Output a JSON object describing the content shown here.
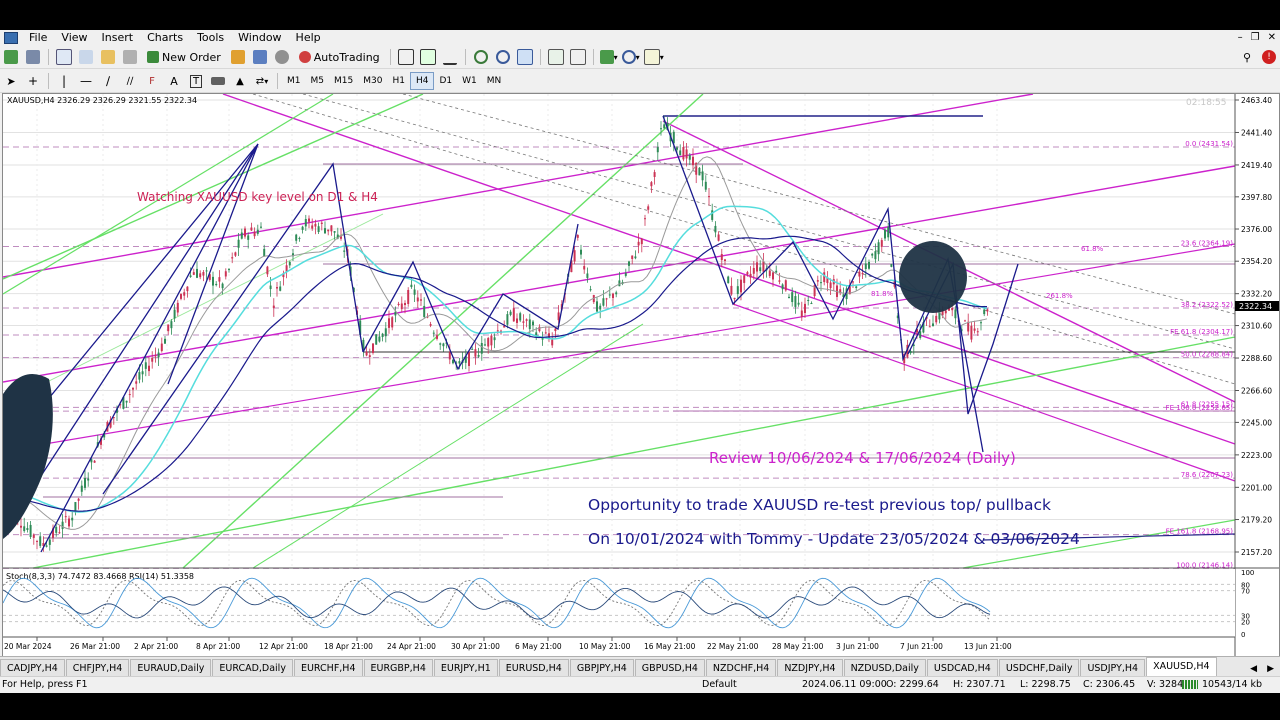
{
  "menu": [
    "File",
    "View",
    "Insert",
    "Charts",
    "Tools",
    "Window",
    "Help"
  ],
  "toolbar": {
    "new_order": "New Order",
    "autotrading": "AutoTrading"
  },
  "timeframes": [
    "M1",
    "M5",
    "M15",
    "M30",
    "H1",
    "H4",
    "D1",
    "W1",
    "MN"
  ],
  "active_timeframe": "H4",
  "chart": {
    "header": "XAUUSD,H4  2326.29 2326.29 2321.55 2322.34",
    "timer": "02:18:55",
    "annotations": {
      "watching": "Watching XAUUSD key level on D1 & H4",
      "review": "Review 10/06/2024 & 17/06/2024 (Daily)",
      "opportunity": "Opportunity to trade XAUUSD re-test previous top/ pullback",
      "update": "On 10/01/2024 with Tommy - Update 23/05/2024 & 03/06/2024"
    },
    "price_labels": [
      "2463.40",
      "2441.40",
      "2419.40",
      "2397.80",
      "2376.00",
      "2354.20",
      "2332.20",
      "2310.60",
      "2288.60",
      "2266.60",
      "2245.00",
      "2223.00",
      "2201.00",
      "2179.20",
      "2157.20"
    ],
    "current_price": "2322.34",
    "fib_labels": [
      {
        "text": "0.0 (2431.54)",
        "price": 2431.54
      },
      {
        "text": "23.6 (2364.19)",
        "price": 2364.19
      },
      {
        "text": "38.2 (2322.52)",
        "price": 2322.52
      },
      {
        "text": "FE 61.8 (2304.17)",
        "price": 2304.17
      },
      {
        "text": "50.0 (2288.84)",
        "price": 2288.84
      },
      {
        "text": "61.8 (2255.15)",
        "price": 2255.15
      },
      {
        "text": "FE 100.0 (2252.65)",
        "price": 2252.65
      },
      {
        "text": "78.6 (2207.23)",
        "price": 2207.23
      },
      {
        "text": "FE 161.8 (2168.95)",
        "price": 2168.95
      },
      {
        "text": "100.0 (2146.14)",
        "price": 2146.14
      }
    ],
    "small_labels": [
      "61.8%",
      "261.8%",
      "81.8%"
    ],
    "indicator_header": "Stoch(8,3,3) 74.7472 83.4668  RSI(14) 51.3358",
    "indicator_labels": [
      "100",
      "80",
      "70",
      "30",
      "20",
      "0"
    ],
    "time_labels": [
      "20 Mar 2024",
      "26 Mar 21:00",
      "2 Apr 21:00",
      "8 Apr 21:00",
      "12 Apr 21:00",
      "18 Apr 21:00",
      "24 Apr 21:00",
      "30 Apr 21:00",
      "6 May 21:00",
      "10 May 21:00",
      "16 May 21:00",
      "22 May 21:00",
      "28 May 21:00",
      "3 Jun 21:00",
      "7 Jun 21:00",
      "13 Jun 21:00"
    ]
  },
  "tabs": [
    "CADJPY,H4",
    "CHFJPY,H4",
    "EURAUD,Daily",
    "EURCAD,Daily",
    "EURCHF,H4",
    "EURGBP,H4",
    "EURJPY,H1",
    "EURUSD,H4",
    "GBPJPY,H4",
    "GBPUSD,H4",
    "NZDCHF,H4",
    "NZDJPY,H4",
    "NZDUSD,Daily",
    "USDCAD,H4",
    "USDCHF,Daily",
    "USDJPY,H4",
    "XAUUSD,H4"
  ],
  "active_tab": "XAUUSD,H4",
  "status": {
    "help": "For Help, press F1",
    "profile": "Default",
    "time": "2024.06.11 09:00",
    "open": "O: 2299.64",
    "high": "H: 2307.71",
    "low": "L: 2298.75",
    "close": "C: 2306.45",
    "volume": "V: 32843",
    "traffic": "10543/14 kb"
  },
  "colors": {
    "magenta": "#cc22cc",
    "navy": "#1a1a8c",
    "green": "#66e066",
    "aqua": "#55dddd",
    "candle_up": "#2e8b57",
    "candle_down": "#cc3355"
  }
}
